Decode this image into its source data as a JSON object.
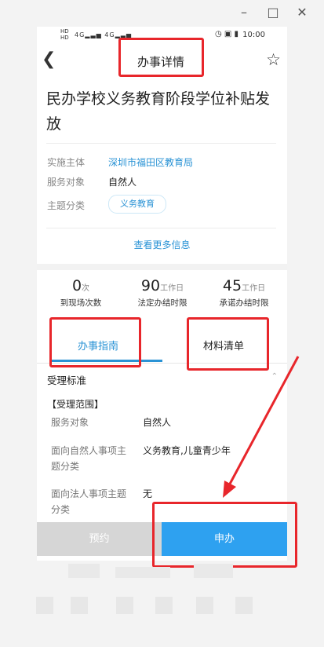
{
  "window": {
    "minimize_icon": "minimize-icon",
    "maximize_icon": "maximize-icon",
    "close_icon": "close-icon"
  },
  "statusbar": {
    "signal_text_1": "HD",
    "signal_text_2": "HD",
    "net_1": "4G",
    "net_2": "4G",
    "time": "10:00"
  },
  "navbar": {
    "title": "办事详情",
    "back_icon": "back-icon",
    "favorite_icon": "star-icon"
  },
  "item": {
    "title": "民办学校义务教育阶段学位补贴发放",
    "fields": [
      {
        "label": "实施主体",
        "value": "深圳市福田区教育局"
      },
      {
        "label": "服务对象",
        "value": "自然人"
      },
      {
        "label": "主题分类",
        "value": "义务教育"
      }
    ],
    "more_link": "查看更多信息"
  },
  "stats": [
    {
      "number": "0",
      "unit": "次",
      "label": "到现场次数"
    },
    {
      "number": "90",
      "unit": "工作日",
      "label": "法定办结时限"
    },
    {
      "number": "45",
      "unit": "工作日",
      "label": "承诺办结时限"
    }
  ],
  "tabs": {
    "guide": "办事指南",
    "materials": "材料清单"
  },
  "guide": {
    "section_title": "受理标准",
    "range_title": "【受理范围】",
    "rows": [
      {
        "label": "服务对象",
        "value": "自然人"
      },
      {
        "label": "面向自然人事项主题分类",
        "value": "义务教育,儿童青少年"
      },
      {
        "label": "面向法人事项主题分类",
        "value": "无"
      }
    ]
  },
  "actions": {
    "book": "预约",
    "apply": "申办"
  },
  "colors": {
    "accent": "#2a93d5",
    "apply_button": "#2ea1f0",
    "highlight": "#e8262b"
  }
}
